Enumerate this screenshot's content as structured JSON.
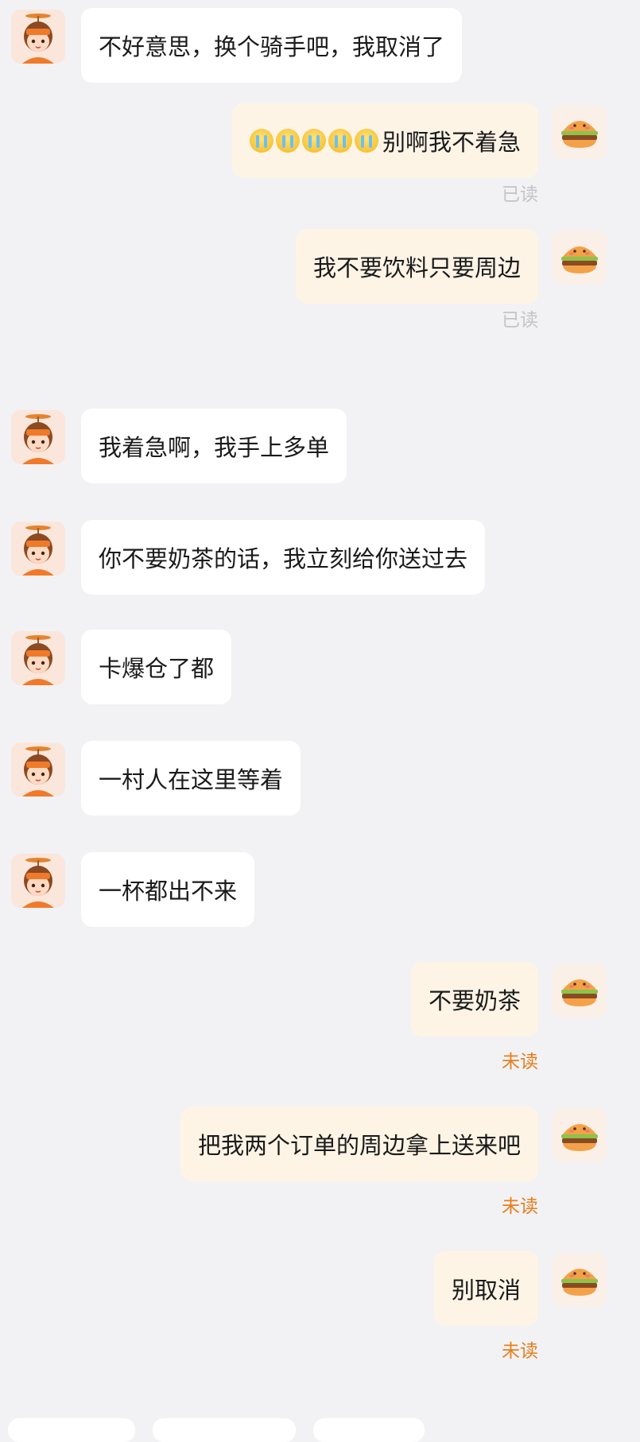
{
  "messages": [
    {
      "side": "other",
      "text": "不好意思，换个骑手吧，我取消了"
    },
    {
      "side": "me",
      "text": "别啊我不着急",
      "emoji_count": 5,
      "emoji_name": "crying-face-emoji",
      "status": "已读"
    },
    {
      "side": "me",
      "text": "我不要饮料只要周边",
      "status": "已读"
    },
    {
      "side": "other",
      "text": "我着急啊，我手上多单"
    },
    {
      "side": "other",
      "text": "你不要奶茶的话，我立刻给你送过去"
    },
    {
      "side": "other",
      "text": "卡爆仓了都"
    },
    {
      "side": "other",
      "text": "一村人在这里等着"
    },
    {
      "side": "other",
      "text": "一杯都出不来"
    },
    {
      "side": "me",
      "text": "不要奶茶",
      "status": "未读"
    },
    {
      "side": "me",
      "text": "把我两个订单的周边拿上送来吧",
      "status": "未读"
    },
    {
      "side": "me",
      "text": "别取消",
      "status": "未读"
    }
  ],
  "colors": {
    "background": "#f2f2f4",
    "bubble_other": "#ffffff",
    "bubble_mine": "#fdf4e6",
    "status_read": "#c4c4c8",
    "status_unread": "#e77e1d"
  },
  "icons": {
    "other_avatar": "courier-avatar-icon",
    "my_avatar": "burger-avatar-icon"
  }
}
